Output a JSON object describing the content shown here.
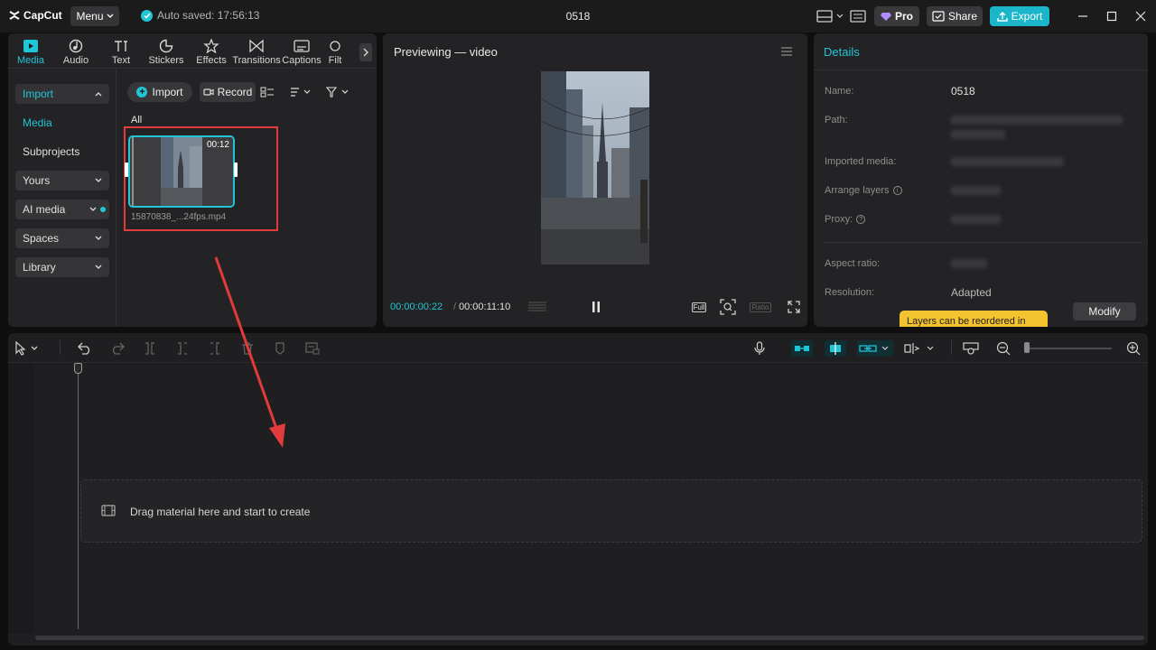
{
  "app": {
    "logo_text": "CapCut",
    "menu_label": "Menu",
    "autosave_text": "Auto saved: 17:56:13",
    "project_title": "0518",
    "pro_label": "Pro",
    "share_label": "Share",
    "export_label": "Export"
  },
  "media_tabs": [
    {
      "label": "Media",
      "icon": "media-icon"
    },
    {
      "label": "Audio",
      "icon": "audio-icon"
    },
    {
      "label": "Text",
      "icon": "text-icon"
    },
    {
      "label": "Stickers",
      "icon": "stickers-icon"
    },
    {
      "label": "Effects",
      "icon": "effects-icon"
    },
    {
      "label": "Transitions",
      "icon": "transitions-icon"
    },
    {
      "label": "Captions",
      "icon": "captions-icon"
    },
    {
      "label": "Filt",
      "icon": "filters-icon"
    }
  ],
  "side_nav": {
    "import": "Import",
    "media": "Media",
    "subprojects": "Subprojects",
    "yours": "Yours",
    "ai_media": "AI media",
    "spaces": "Spaces",
    "library": "Library"
  },
  "media_toolbar": {
    "import_label": "Import",
    "record_label": "Record"
  },
  "media_library": {
    "filter_label": "All",
    "clip": {
      "duration": "00:12",
      "filename": "15870838_...24fps.mp4"
    }
  },
  "preview": {
    "title": "Previewing — video",
    "current_time": "00:00:00:22",
    "separator": "/",
    "total_time": "00:00:11:10",
    "full_label": "Full",
    "ratio_label": "Ratio"
  },
  "details": {
    "title": "Details",
    "name_label": "Name:",
    "name_value": "0518",
    "path_label": "Path:",
    "imported_media_label": "Imported media:",
    "arrange_layers_label": "Arrange layers",
    "proxy_label": "Proxy:",
    "aspect_ratio_label": "Aspect ratio:",
    "resolution_label": "Resolution:",
    "resolution_value": "Adapted",
    "tooltip_text": "Layers can be reordered in",
    "modify_label": "Modify"
  },
  "timeline": {
    "drop_text": "Drag material here and start to create"
  },
  "colors": {
    "accent": "#22c5d6",
    "annotation_red": "#e23b3b",
    "tooltip_yellow": "#f4c430",
    "background": "#0f0f10",
    "panel": "#232325"
  }
}
